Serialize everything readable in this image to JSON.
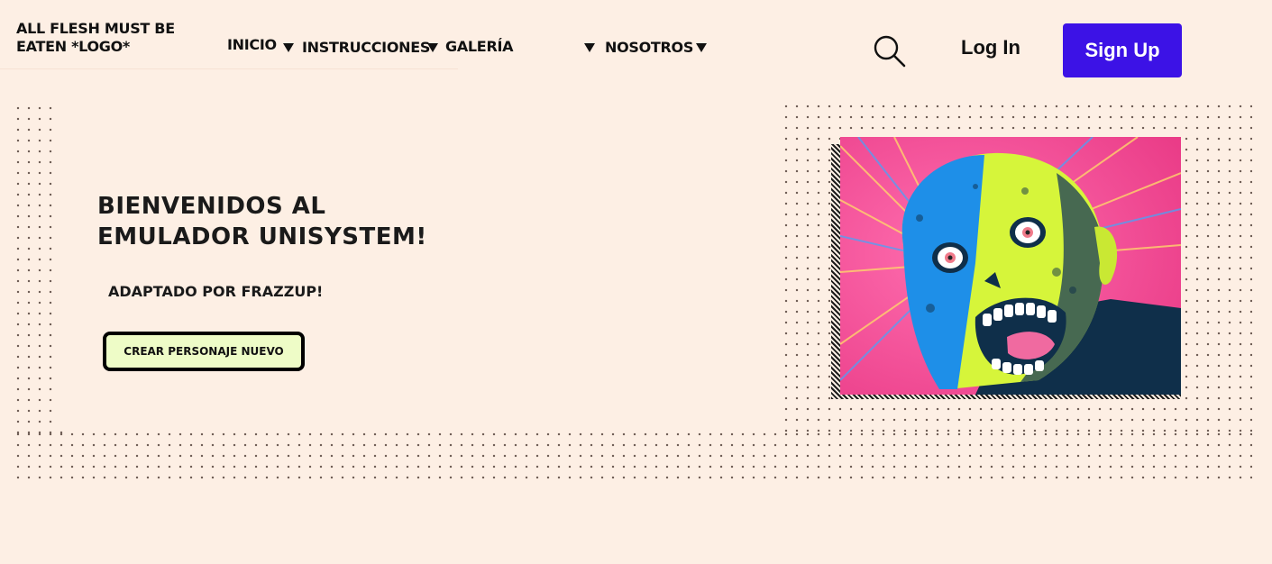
{
  "header": {
    "logo_text": "ALL FLESH MUST BE EATEN *LOGO*",
    "nav": [
      {
        "label": "INICIO"
      },
      {
        "label": "INSTRUCCIONES"
      },
      {
        "label": "GALERÍA"
      },
      {
        "label": "NOSOTROS"
      }
    ],
    "search_icon": "search-icon",
    "login_label": "Log In",
    "signup_label": "Sign Up"
  },
  "hero": {
    "title": "BIENVENIDOS AL EMULADOR UNISYSTEM!",
    "subtitle": "ADAPTADO POR FRAZZUP!",
    "cta_label": "CREAR PERSONAJE NUEVO",
    "image": "zombie-illustration"
  },
  "colors": {
    "background": "#fdefe4",
    "signup_button": "#3c12e6",
    "cta_background": "#eefcc7",
    "image_pink": "#f2428f",
    "image_yellow": "#d6f53a",
    "image_blue": "#1e8fe8"
  }
}
